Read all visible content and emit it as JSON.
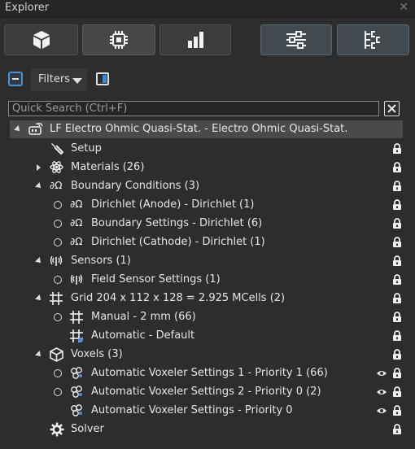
{
  "window": {
    "title": "Explorer",
    "close_glyph": "✕"
  },
  "toolbar": {
    "buttons": [
      {
        "name": "cube-icon"
      },
      {
        "name": "chip-icon"
      },
      {
        "name": "bar-chart-icon"
      },
      {
        "name": "sliders-icon"
      },
      {
        "name": "hierarchy-icon"
      }
    ]
  },
  "controls": {
    "filters_label": "Filters"
  },
  "search": {
    "placeholder": "Quick Search (Ctrl+F)",
    "value": ""
  },
  "tree": {
    "root": "LF Electro Ohmic Quasi-Stat. - Electro Ohmic Quasi-Stat.",
    "setup": "Setup",
    "materials": "Materials (26)",
    "boundary_conditions": "Boundary Conditions (3)",
    "bc_items": [
      "Dirichlet (Anode) - Dirichlet (1)",
      "Boundary Settings - Dirichlet (6)",
      "Dirichlet (Cathode) - Dirichlet (1)"
    ],
    "sensors": "Sensors (1)",
    "sensor_items": [
      "Field Sensor Settings (1)"
    ],
    "grid": "Grid 204 x 112 x 128 = 2.925 MCells (2)",
    "grid_items": [
      "Manual - 2 mm (66)",
      "Automatic - Default"
    ],
    "voxels": "Voxels (3)",
    "voxel_items": [
      "Automatic Voxeler Settings 1 - Priority 1 (66)",
      "Automatic Voxeler Settings 2 - Priority 0 (2)",
      "Automatic Voxeler Settings - Priority 0"
    ],
    "solver": "Solver"
  },
  "colors": {
    "accent": "#4a90d9",
    "background": "#2d2d2d",
    "selected_row": "#4a4a4a"
  }
}
